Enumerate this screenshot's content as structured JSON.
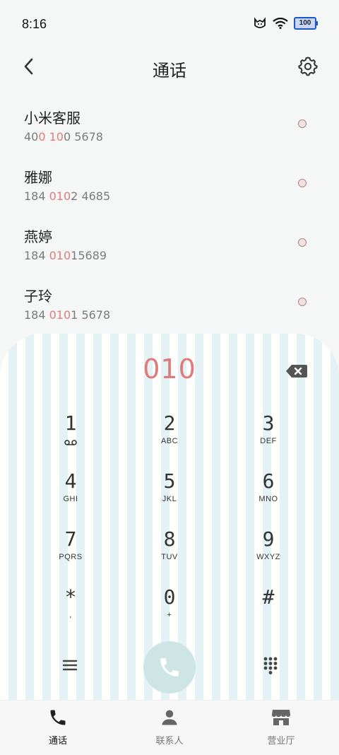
{
  "status": {
    "time": "8:16",
    "battery": "100"
  },
  "header": {
    "title": "通话"
  },
  "contacts": [
    {
      "name": "小米客服",
      "number_parts": [
        "40",
        "0 10",
        "0 5678"
      ]
    },
    {
      "name": "雅娜",
      "number_parts": [
        "184 ",
        "010",
        "2 4685"
      ]
    },
    {
      "name": "燕婷",
      "number_parts": [
        "184 ",
        "010",
        "15689"
      ]
    },
    {
      "name": "子玲",
      "number_parts": [
        "184 ",
        "010",
        "1 5678"
      ]
    }
  ],
  "dial": {
    "display": "010"
  },
  "keys": [
    {
      "digit": "1",
      "letters": ""
    },
    {
      "digit": "2",
      "letters": "ABC"
    },
    {
      "digit": "3",
      "letters": "DEF"
    },
    {
      "digit": "4",
      "letters": "GHI"
    },
    {
      "digit": "5",
      "letters": "JKL"
    },
    {
      "digit": "6",
      "letters": "MNO"
    },
    {
      "digit": "7",
      "letters": "PQRS"
    },
    {
      "digit": "8",
      "letters": "TUV"
    },
    {
      "digit": "9",
      "letters": "WXYZ"
    },
    {
      "digit": "*",
      "letters": ","
    },
    {
      "digit": "0",
      "letters": "+"
    },
    {
      "digit": "#",
      "letters": ""
    }
  ],
  "nav": {
    "calls": "通话",
    "contacts": "联系人",
    "store": "营业厅"
  },
  "colors": {
    "accent": "#e07b7b",
    "call_button": "#cde6e5"
  }
}
